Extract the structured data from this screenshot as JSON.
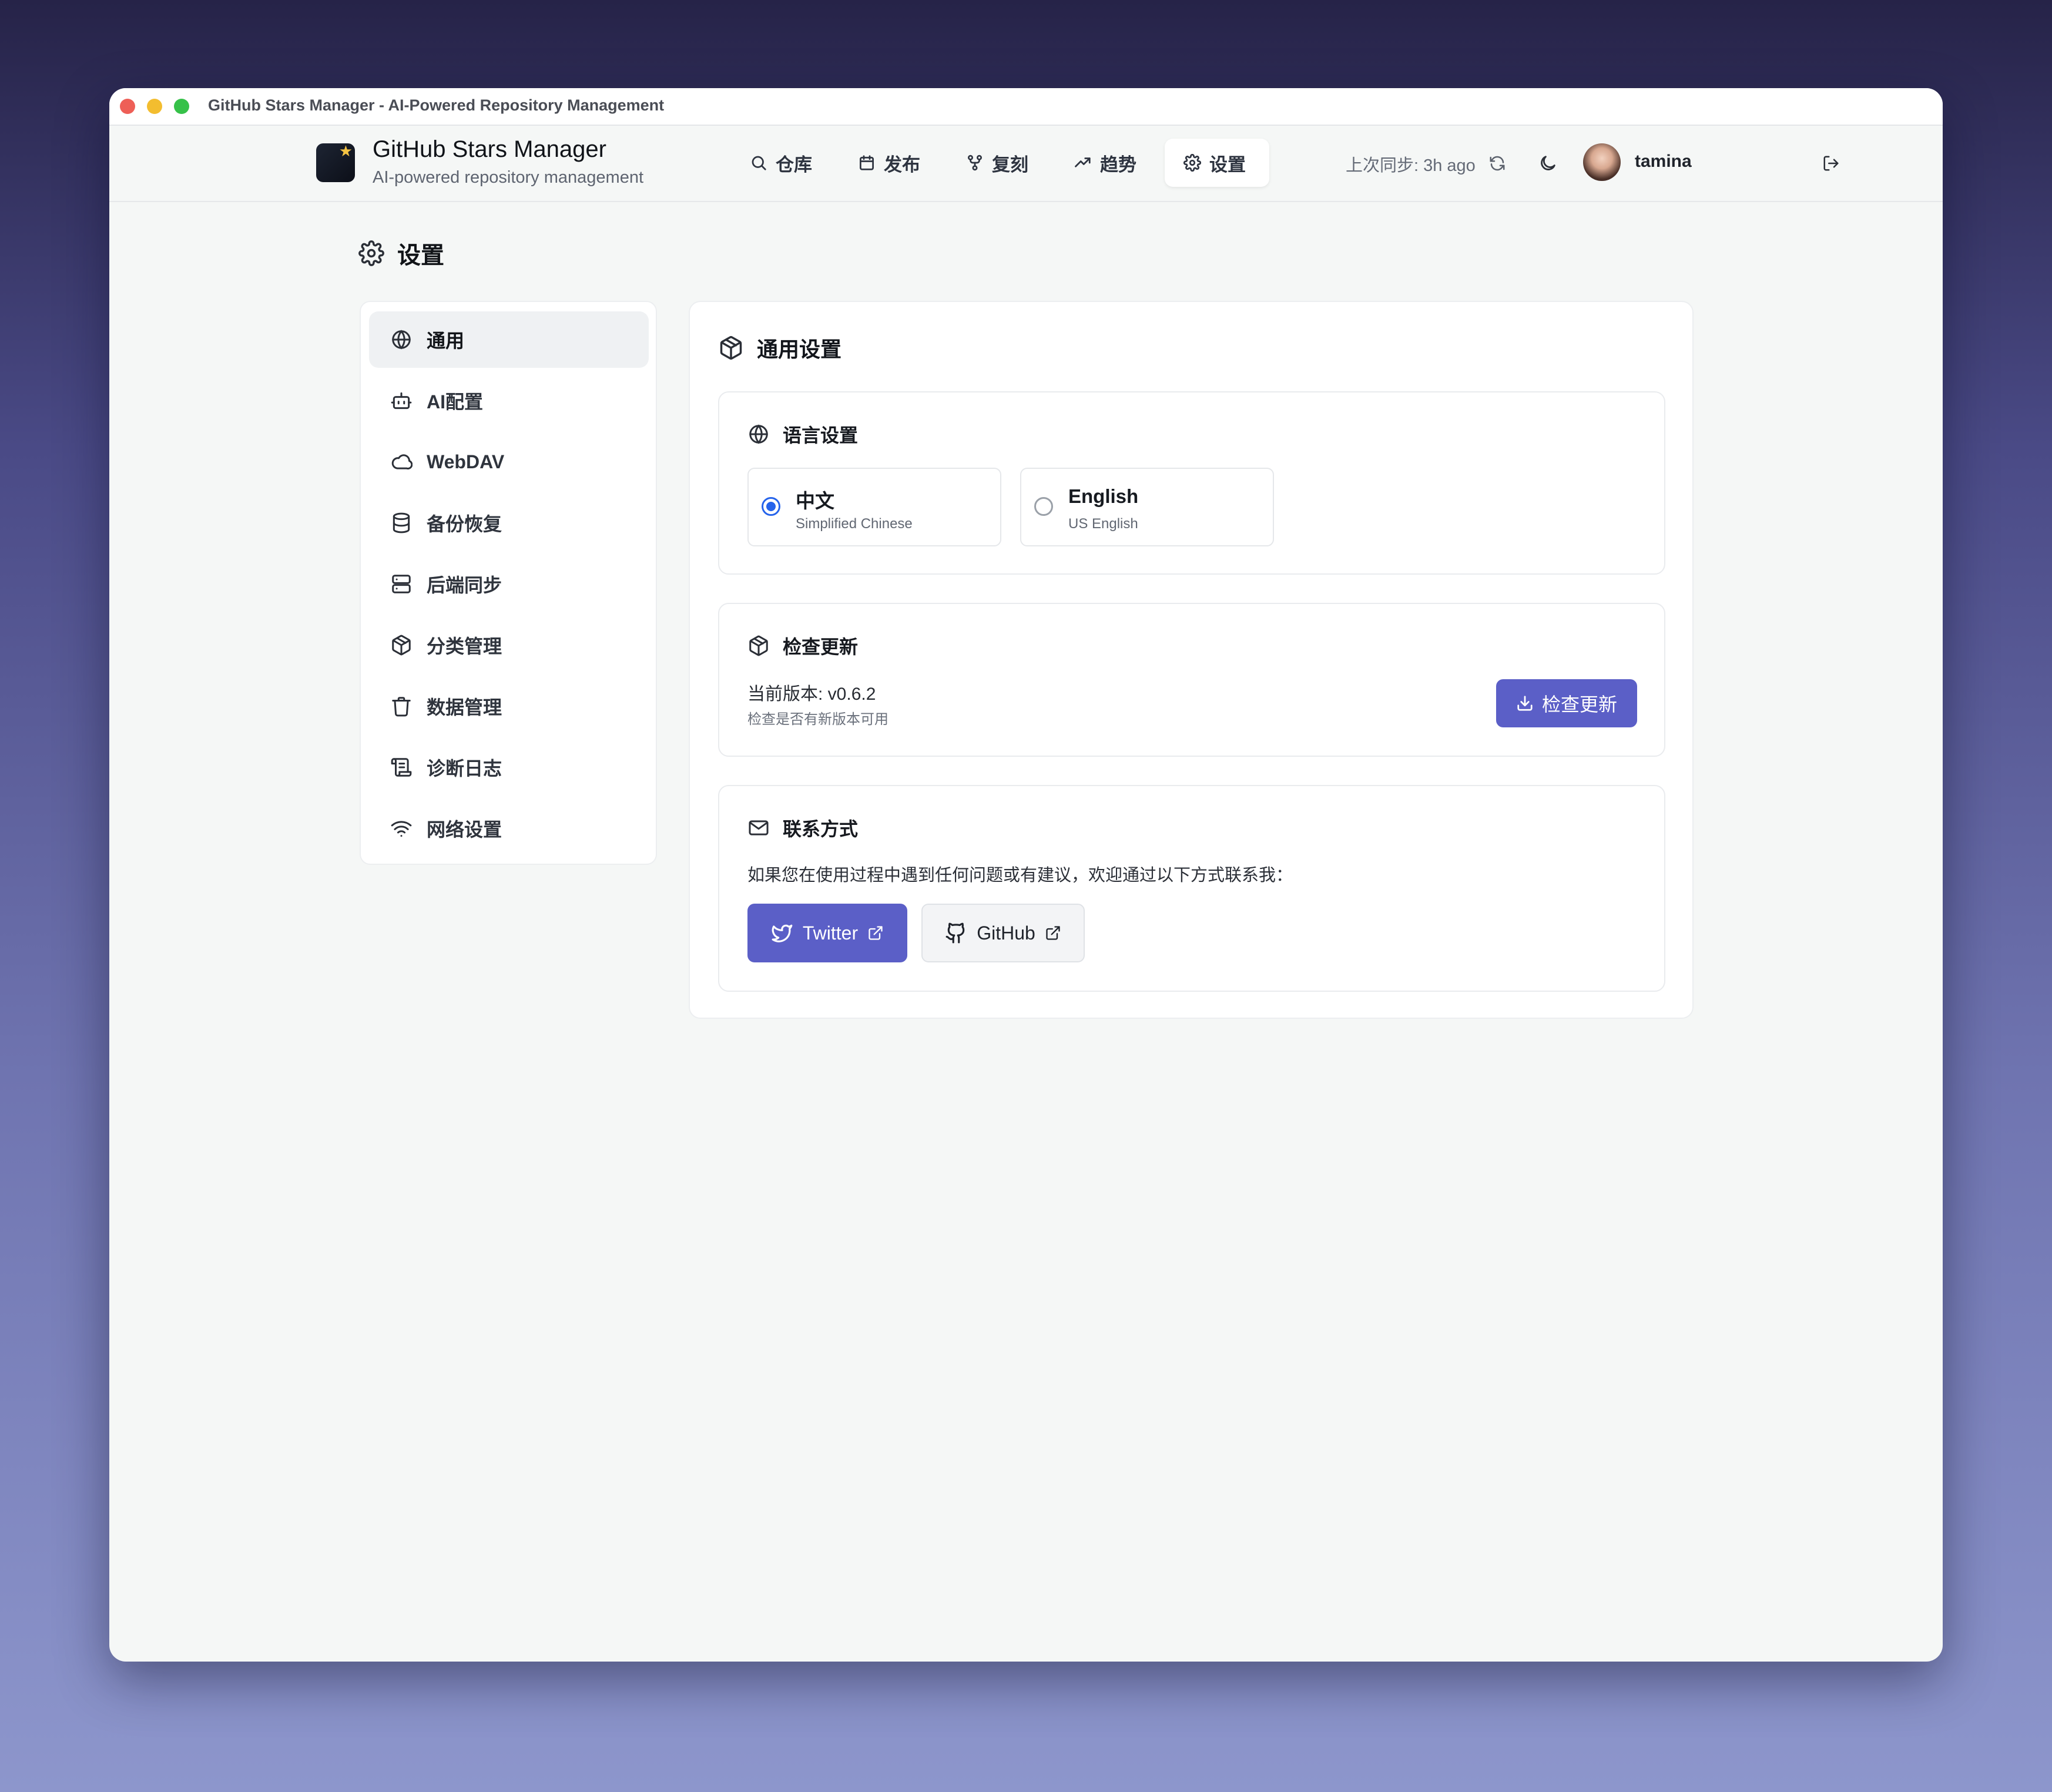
{
  "window": {
    "title": "GitHub Stars Manager - AI-Powered Repository Management"
  },
  "header": {
    "app_title": "GitHub Stars Manager",
    "app_subtitle": "AI-powered repository management",
    "nav": [
      {
        "label": "仓库",
        "icon": "search-icon"
      },
      {
        "label": "发布",
        "icon": "calendar-icon"
      },
      {
        "label": "复刻",
        "icon": "git-fork-icon"
      },
      {
        "label": "趋势",
        "icon": "trending-up-icon"
      },
      {
        "label": "设置",
        "icon": "gear-icon",
        "active": true
      }
    ],
    "sync_status": "上次同步: 3h ago",
    "username": "tamina"
  },
  "page": {
    "title": "设置"
  },
  "sidebar": {
    "items": [
      {
        "label": "通用",
        "icon": "globe-icon",
        "active": true
      },
      {
        "label": "AI配置",
        "icon": "bot-icon"
      },
      {
        "label": "WebDAV",
        "icon": "cloud-icon"
      },
      {
        "label": "备份恢复",
        "icon": "database-icon"
      },
      {
        "label": "后端同步",
        "icon": "server-icon"
      },
      {
        "label": "分类管理",
        "icon": "package-icon"
      },
      {
        "label": "数据管理",
        "icon": "trash-icon"
      },
      {
        "label": "诊断日志",
        "icon": "scroll-icon"
      },
      {
        "label": "网络设置",
        "icon": "wifi-icon"
      }
    ]
  },
  "main": {
    "title": "通用设置",
    "language": {
      "title": "语言设置",
      "options": [
        {
          "name": "中文",
          "desc": "Simplified Chinese",
          "selected": true
        },
        {
          "name": "English",
          "desc": "US English",
          "selected": false
        }
      ]
    },
    "update": {
      "title": "检查更新",
      "current_version": "当前版本: v0.6.2",
      "hint": "检查是否有新版本可用",
      "button": "检查更新"
    },
    "contact": {
      "title": "联系方式",
      "text": "如果您在使用过程中遇到任何问题或有建议，欢迎通过以下方式联系我：",
      "twitter_label": "Twitter",
      "github_label": "GitHub"
    }
  },
  "colors": {
    "accent": "#5b5fc7",
    "radio": "#2563eb"
  }
}
